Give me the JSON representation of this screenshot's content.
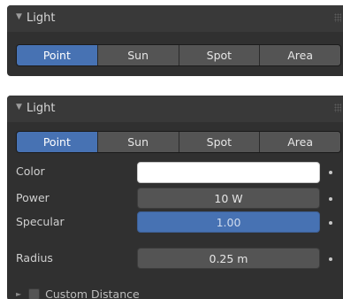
{
  "top_panel": {
    "title": "Light",
    "light_types": [
      "Point",
      "Sun",
      "Spot",
      "Area"
    ],
    "active_type": "Point"
  },
  "bottom_panel": {
    "title": "Light",
    "light_types": [
      "Point",
      "Sun",
      "Spot",
      "Area"
    ],
    "active_type": "Point",
    "properties": {
      "color": {
        "label": "Color",
        "value_hex": "#ffffff"
      },
      "power": {
        "label": "Power",
        "value": "10 W"
      },
      "specular": {
        "label": "Specular",
        "value": "1.00"
      },
      "radius": {
        "label": "Radius",
        "value": "0.25 m"
      }
    },
    "custom_distance": {
      "label": "Custom Distance",
      "checked": false
    }
  },
  "icons": {
    "collapse": "disclosure-triangle-down-icon",
    "expand": "disclosure-triangle-right-icon",
    "drag": "drag-grip-icon",
    "animate": "keyframe-dot-icon"
  },
  "colors": {
    "panel_bg": "#303030",
    "header_bg": "#393939",
    "button_bg": "#545454",
    "accent": "#4772b3"
  }
}
